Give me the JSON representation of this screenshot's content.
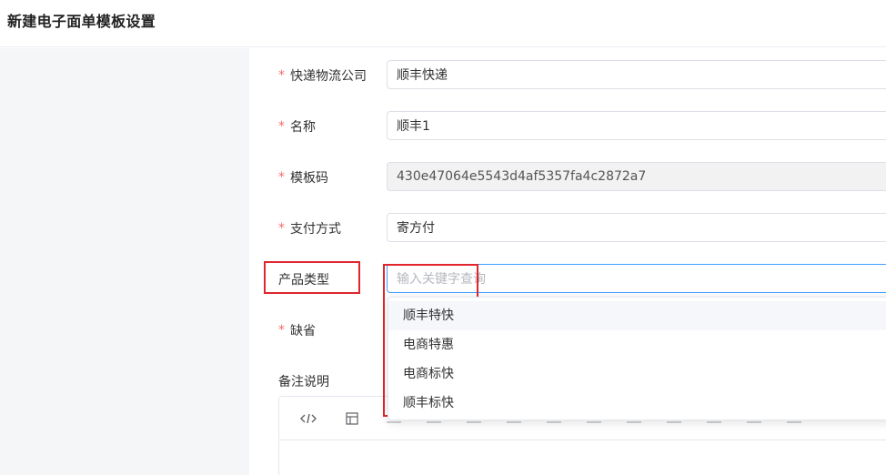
{
  "page": {
    "title": "新建电子面单模板设置"
  },
  "form": {
    "courier": {
      "label": "快递物流公司",
      "value": "顺丰快递",
      "required": true
    },
    "name": {
      "label": "名称",
      "value": "顺丰1",
      "required": true
    },
    "template_code": {
      "label": "模板码",
      "value": "430e47064e5543d4af5357fa4c2872a7",
      "required": true
    },
    "payment": {
      "label": "支付方式",
      "value": "寄方付",
      "required": true
    },
    "product_type": {
      "label": "产品类型",
      "placeholder": "输入关键字查询",
      "options": [
        "顺丰特快",
        "电商特惠",
        "电商标快",
        "顺丰标快"
      ]
    },
    "default": {
      "label": "缺省",
      "required": true
    },
    "remark": {
      "label": "备注说明"
    }
  },
  "editor": {
    "toolbar": [
      "code-view-icon",
      "layout-icon"
    ]
  },
  "colors": {
    "accent": "#409eff",
    "required": "#f56c6c",
    "highlight": "#e0252d"
  }
}
